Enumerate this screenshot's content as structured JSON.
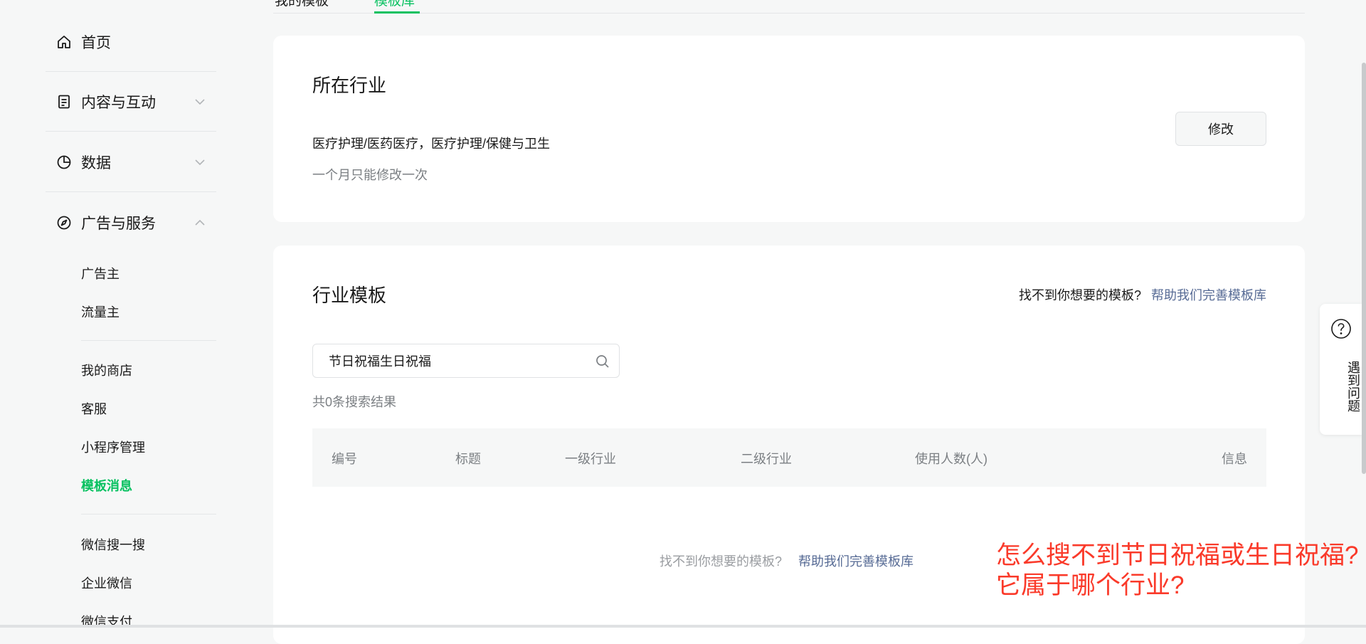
{
  "tabs": [
    "我的模板",
    "模板库"
  ],
  "sidebar": {
    "home": {
      "label": "首页",
      "icon": "home-icon"
    },
    "content": {
      "label": "内容与互动",
      "icon": "document-icon"
    },
    "data": {
      "label": "数据",
      "icon": "pie-chart-icon"
    },
    "ads": {
      "label": "广告与服务",
      "icon": "compass-icon"
    },
    "sub_items": [
      "广告主",
      "流量主",
      "我的商店",
      "客服",
      "小程序管理",
      "模板消息",
      "微信搜一搜",
      "企业微信",
      "微信支付"
    ],
    "active_item": "模板消息"
  },
  "industry": {
    "title": "所在行业",
    "value": "医疗护理/医药医疗，医疗护理/保健与卫生",
    "note": "一个月只能修改一次",
    "modify_button": "修改"
  },
  "templates": {
    "title": "行业模板",
    "help_question": "找不到你想要的模板?",
    "help_link": "帮助我们完善模板库",
    "search_value": "节日祝福生日祝福",
    "result_count": "共0条搜索结果",
    "columns": [
      "编号",
      "标题",
      "一级行业",
      "二级行业",
      "使用人数(人)",
      "信息"
    ],
    "rows": [],
    "empty_question": "找不到你想要的模板?",
    "empty_link": "帮助我们完善模板库"
  },
  "annotation": [
    "怎么搜不到节日祝福或生日祝福?",
    "它属于哪个行业?"
  ],
  "float_help": {
    "label": "遇到问题",
    "icon": "question-icon"
  },
  "colors": {
    "accent": "#07c160",
    "link": "#576b95",
    "annotation": "#fa3a2a"
  }
}
